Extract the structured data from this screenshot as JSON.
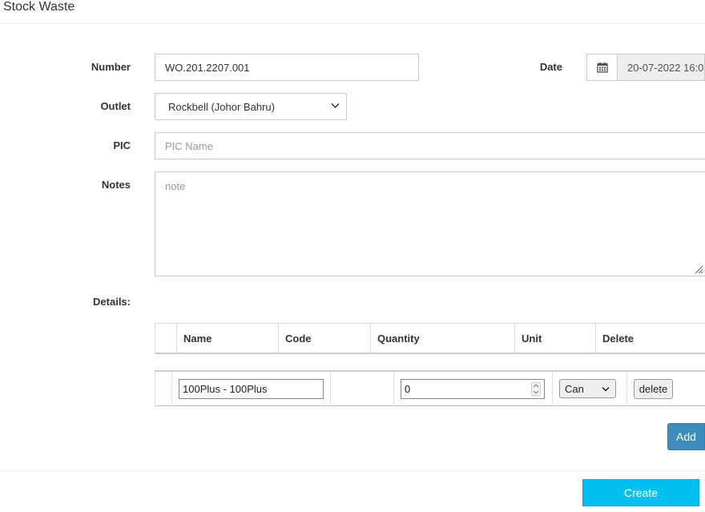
{
  "page": {
    "title": "Stock Waste"
  },
  "form": {
    "number_label": "Number",
    "number_value": "WO.201.2207.001",
    "date_label": "Date",
    "date_value": "20-07-2022 16:0",
    "outlet_label": "Outlet",
    "outlet_value": "Rockbell (Johor Bahru)",
    "pic_label": "PIC",
    "pic_placeholder": "PIC Name",
    "notes_label": "Notes",
    "notes_placeholder": "note",
    "details_label": "Details:"
  },
  "details_table": {
    "headers": {
      "name": "Name",
      "code": "Code",
      "quantity": "Quantity",
      "unit": "Unit",
      "delete": "Delete"
    },
    "rows": [
      {
        "name": "100Plus - 100Plus",
        "code": "",
        "quantity": "0",
        "unit": "Can",
        "delete_label": "delete"
      }
    ]
  },
  "actions": {
    "add_label": "Add",
    "create_label": "Create"
  },
  "icons": {
    "date": "calendar-icon",
    "outlet_select": "chevron-down-icon",
    "unit_select": "chevron-down-icon",
    "notes_resize": "resize-handle-icon"
  },
  "colors": {
    "add_button": "#3c8dbc",
    "create_button": "#00c0ef",
    "readonly_bg": "#eeeeee"
  }
}
